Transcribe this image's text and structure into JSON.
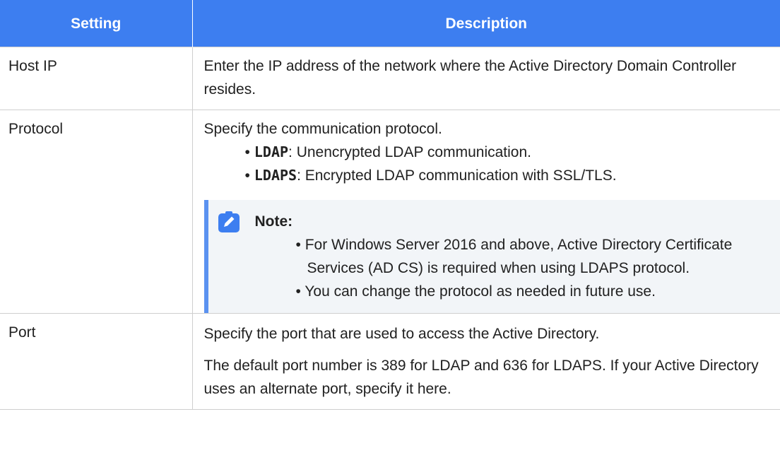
{
  "header": {
    "col1": "Setting",
    "col2": "Description"
  },
  "rows": [
    {
      "setting": "Host IP",
      "description": "Enter the IP address of the network where the Active Directory Domain Controller resides."
    },
    {
      "setting": "Protocol",
      "description": "Specify the communication protocol.",
      "options": [
        {
          "term": "LDAP",
          "text": ": Unencrypted LDAP communication."
        },
        {
          "term": "LDAPS",
          "text": ": Encrypted LDAP communication with SSL/TLS."
        }
      ],
      "note": {
        "icon": "pencil-note-icon",
        "title": "Note:",
        "items": [
          "For Windows Server 2016 and above, Active Directory Certificate Services (AD CS) is required when using LDAPS protocol.",
          "You can change the protocol as needed in future use."
        ]
      }
    },
    {
      "setting": "Port",
      "paragraphs": [
        "Specify the port that are used to access the Active Directory.",
        "The default port number is 389 for LDAP and 636 for LDAPS. If your Active Directory uses an alternate port, specify it here."
      ]
    }
  ],
  "colors": {
    "header_bg": "#3d7ef0",
    "note_bg": "#f2f5f8",
    "note_accent": "#5b92f0"
  }
}
